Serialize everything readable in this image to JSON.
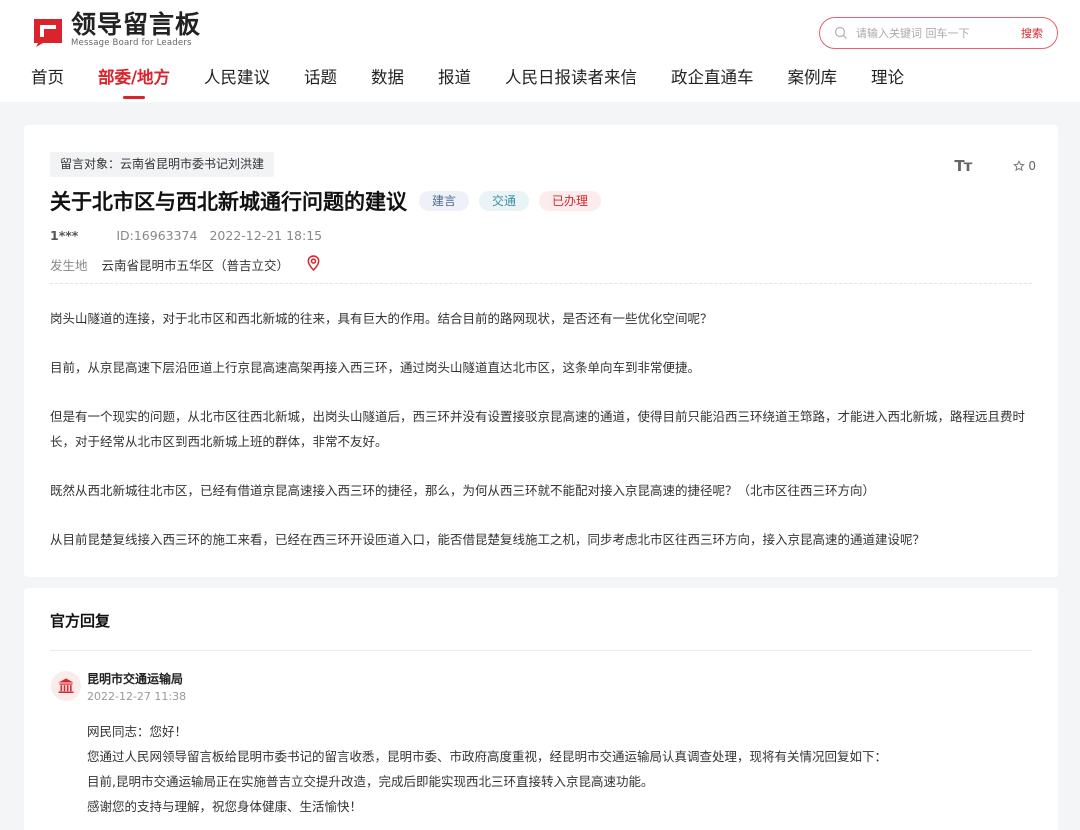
{
  "logo": {
    "cn": "领导留言板",
    "en": "Message Board for Leaders"
  },
  "search": {
    "placeholder": "请输入关键词 回车一下",
    "button": "搜索"
  },
  "nav": [
    "首页",
    "部委/地方",
    "人民建议",
    "话题",
    "数据",
    "报道",
    "人民日报读者来信",
    "政企直通车",
    "案例库",
    "理论"
  ],
  "message": {
    "target": "留言对象：云南省昆明市委书记刘洪建",
    "font_tool": "Tт",
    "star_count": "0",
    "title": "关于北市区与西北新城通行问题的建议",
    "tags": [
      "建言",
      "交通",
      "已办理"
    ],
    "author": "1***",
    "id": "ID:16963374",
    "datetime": "2022-12-21 18:15",
    "place_label": "发生地",
    "place": "云南省昆明市五华区（普吉立交）",
    "paragraphs": [
      "岗头山隧道的连接，对于北市区和西北新城的往来，具有巨大的作用。结合目前的路网现状，是否还有一些优化空间呢？",
      "目前，从京昆高速下层沿匝道上行京昆高速高架再接入西三环，通过岗头山隧道直达北市区，这条单向车到非常便捷。",
      "但是有一个现实的问题，从北市区往西北新城，出岗头山隧道后，西三环并没有设置接驳京昆高速的通道，使得目前只能沿西三环绕道王筇路，才能进入西北新城，路程远且费时长，对于经常从北市区到西北新城上班的群体，非常不友好。",
      "既然从西北新城往北市区，已经有借道京昆高速接入西三环的捷径，那么，为何从西三环就不能配对接入京昆高速的捷径呢？（北市区往西三环方向）",
      "从目前昆楚复线接入西三环的施工来看，已经在西三环开设匝道入口，能否借昆楚复线施工之机，同步考虑北市区往西三环方向，接入京昆高速的通道建设呢？"
    ]
  },
  "reply": {
    "title": "官方回复",
    "org": "昆明市交通运输局",
    "datetime": "2022-12-27 11:38",
    "lines": [
      "网民同志：您好！",
      "您通过人民网领导留言板给昆明市委书记的留言收悉，昆明市委、市政府高度重视，经昆明市交通运输局认真调查处理，现将有关情况回复如下：",
      "目前,昆明市交通运输局正在实施普吉立交提升改造，完成后即能实现西北三环直接转入京昆高速功能。",
      "感谢您的支持与理解，祝您身体健康、生活愉快！"
    ]
  },
  "colors": {
    "brand": "#d9232d",
    "background": "#f4f5f7"
  }
}
